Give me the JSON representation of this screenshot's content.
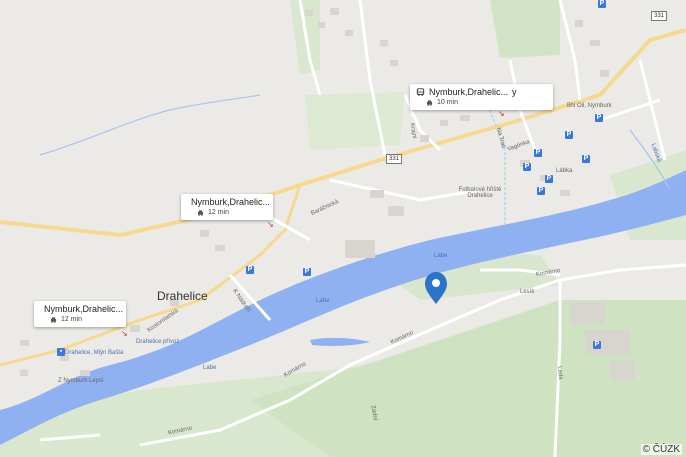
{
  "map": {
    "town": "Drahelice",
    "river": "Labe",
    "copyright": "© ČÚZK",
    "road_number": "331",
    "road_number_2": "331",
    "streets": {
      "komarno_1": "Komárno",
      "komarno_2": "Komárno",
      "komarno_3": "Komárno",
      "komarno_4": "Komárno",
      "barakova": "Baráčnická",
      "k_nadrazi": "K Nádraží",
      "kostomlatska": "Kostomlatská",
      "vagonka": "Vagónka",
      "zadni": "Zadní",
      "ledbr": "Lada",
      "labska": "Labská",
      "krajni": "Krajní",
      "na_trati": "Na Trati",
      "libka": "Lábka"
    },
    "pois": {
      "drahelice_prevoz": "Drahelice přívoz",
      "drahelice_mlyn": "Drahelice, Mlýn Bašta",
      "nymburk_lepsi": "Z Nymburk Lepsí",
      "fotbalove_hriste": "Fotbalové hřiště Drahelice",
      "bn_oil": "BN Oil, Nymburk",
      "lesik": "Lesík"
    }
  },
  "transit_popups": [
    {
      "title": "Nymburk,Drahelic...",
      "extra": "y",
      "duration": "10 min"
    },
    {
      "title": "Nymburk,Drahelic...",
      "duration": "12 min"
    },
    {
      "title": "Nymburk,Drahelic...",
      "duration": "12 min"
    }
  ],
  "marker": {
    "icon": "location-pin-icon",
    "color": "#2a74c9"
  },
  "colors": {
    "river": "#8fb1f1",
    "land": "#eceae6",
    "green": "#d8e8cf",
    "road_main": "#f6d98f",
    "road": "#ffffff",
    "marker": "#2a74c9"
  }
}
